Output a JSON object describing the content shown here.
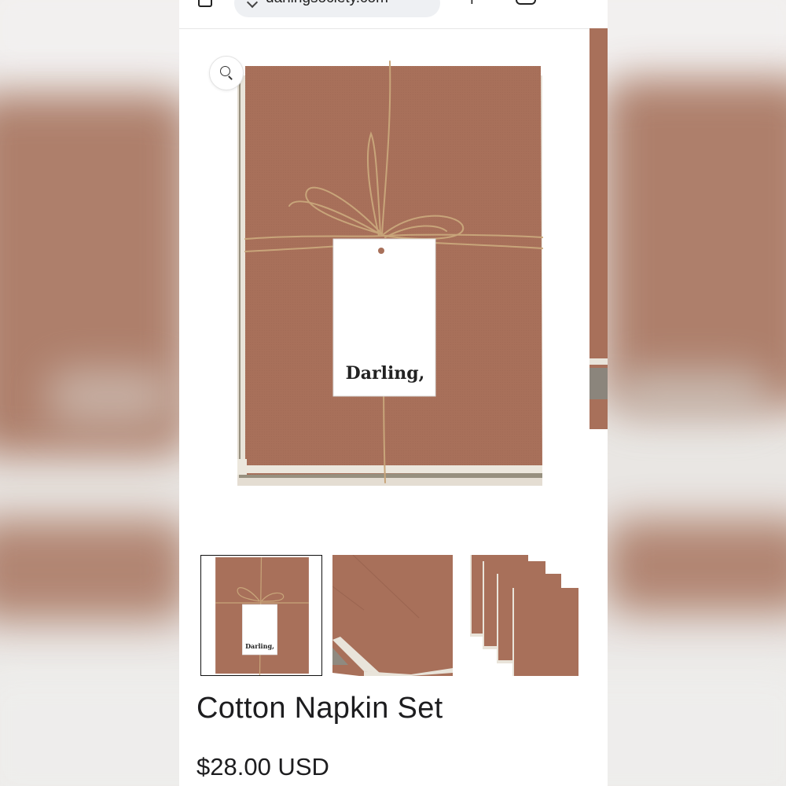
{
  "browser": {
    "url": "darlingsociety.com"
  },
  "product": {
    "title": "Cotton Napkin Set",
    "price": "$28.00 USD",
    "tag_brand": "Darling,",
    "thumb_tag_brand": "Darling,"
  },
  "gallery": {
    "selected_thumbnail": 1,
    "thumbnail_count": 3
  },
  "colors": {
    "napkin": "#a8705a",
    "trim": "#e9e4da",
    "panel_bg": "#ffffff",
    "text": "#1d1d1f"
  },
  "icons": [
    "home-icon",
    "lock-icon",
    "plus-icon",
    "tabs-icon",
    "menu-icon",
    "magnify-icon"
  ]
}
